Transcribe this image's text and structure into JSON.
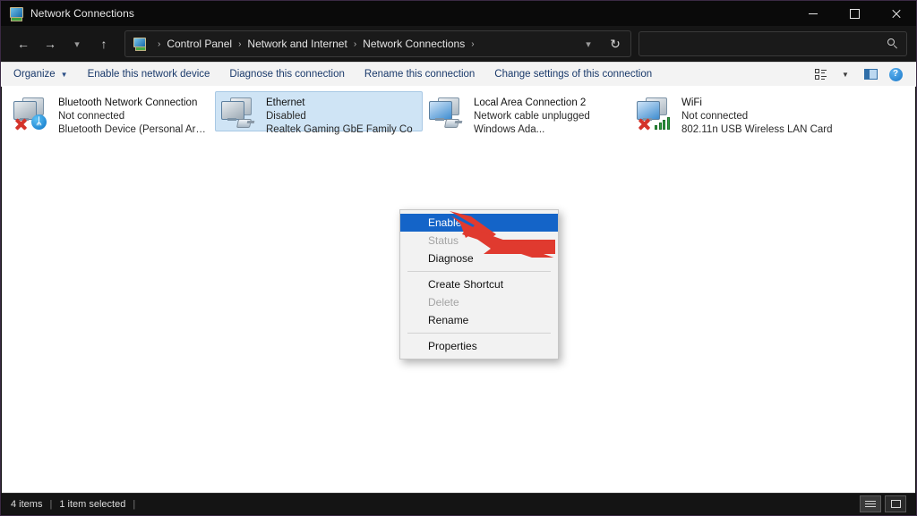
{
  "window": {
    "title": "Network Connections",
    "icon": "network-connections-icon",
    "controls": {
      "minimize": "minimize-icon",
      "maximize": "maximize-icon",
      "close": "close-icon"
    }
  },
  "address_bar": {
    "back": "back-arrow-icon",
    "forward": "forward-arrow-icon",
    "recent": "chevron-down-icon",
    "up": "up-arrow-icon",
    "breadcrumb_icon": "control-panel-icon",
    "breadcrumbs": [
      "Control Panel",
      "Network and Internet",
      "Network Connections"
    ],
    "separator": "›",
    "dropdown": "chevron-down-icon",
    "refresh": "refresh-icon",
    "search": {
      "value": "",
      "placeholder": "",
      "icon": "search-icon"
    }
  },
  "command_bar": {
    "items": [
      {
        "label": "Organize",
        "has_dropdown": true
      },
      {
        "label": "Enable this network device",
        "has_dropdown": false
      },
      {
        "label": "Diagnose this connection",
        "has_dropdown": false
      },
      {
        "label": "Rename this connection",
        "has_dropdown": false
      },
      {
        "label": "Change settings of this connection",
        "has_dropdown": false
      }
    ],
    "right_icons": [
      "view-options-icon",
      "chevron-down-icon",
      "preview-pane-icon",
      "help-icon"
    ],
    "help_glyph": "?"
  },
  "connections": [
    {
      "name": "Bluetooth Network Connection",
      "status": "Not connected",
      "device": "Bluetooth Device (Personal Area ...",
      "selected": false,
      "badge": "bluetooth",
      "disabled_badge": true,
      "bluetooth_glyph": "ᛦ"
    },
    {
      "name": "Ethernet",
      "status": "Disabled",
      "device": "Realtek Gaming GbE Family Co",
      "selected": true,
      "badge": "plug",
      "disabled_badge": false
    },
    {
      "name": "Local Area Connection 2",
      "status": "Network cable unplugged",
      "device": "Windows Ada...",
      "selected": false,
      "badge": "plug",
      "disabled_badge": false
    },
    {
      "name": "WiFi",
      "status": "Not connected",
      "device": "802.11n USB Wireless LAN Card",
      "selected": false,
      "badge": "signal",
      "disabled_badge": true
    }
  ],
  "context_menu": {
    "items": [
      {
        "label": "Enable",
        "shield": true,
        "disabled": false,
        "highlighted": true
      },
      {
        "label": "Status",
        "shield": false,
        "disabled": true,
        "highlighted": false
      },
      {
        "label": "Diagnose",
        "shield": false,
        "disabled": false,
        "highlighted": false
      },
      {
        "separator": true
      },
      {
        "label": "Create Shortcut",
        "shield": false,
        "disabled": false,
        "highlighted": false
      },
      {
        "label": "Delete",
        "shield": true,
        "disabled": true,
        "highlighted": false
      },
      {
        "label": "Rename",
        "shield": true,
        "disabled": false,
        "highlighted": false
      },
      {
        "separator": true
      },
      {
        "label": "Properties",
        "shield": true,
        "disabled": false,
        "highlighted": false
      }
    ]
  },
  "annotation": {
    "arrow_color": "#e03a2f",
    "points_to": "Enable"
  },
  "status_bar": {
    "item_count": "4 items",
    "selection": "1 item selected",
    "divider": "|",
    "views": [
      "details-view-icon",
      "large-icons-view-icon"
    ]
  }
}
